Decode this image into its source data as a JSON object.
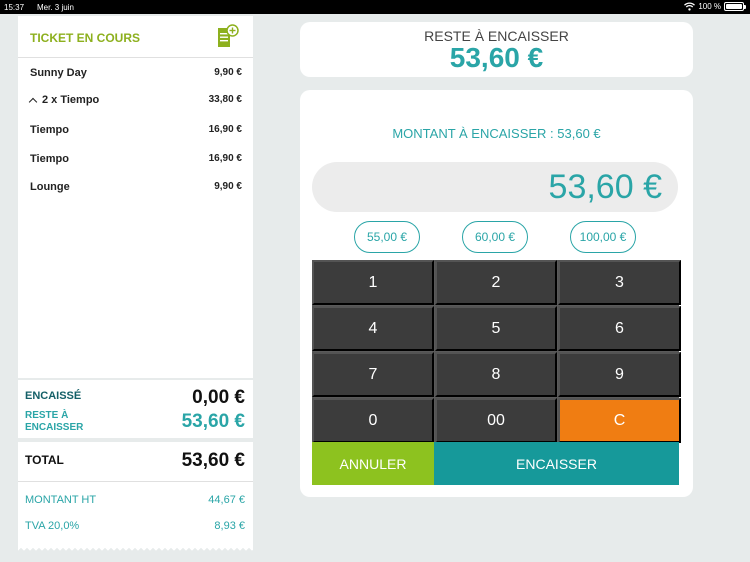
{
  "status_bar": {
    "time": "15:37",
    "date": "Mer. 3 juin",
    "battery": "100 %"
  },
  "ticket": {
    "title": "TICKET EN COURS",
    "items": [
      {
        "name": "Sunny Day",
        "price": "9,90 €"
      },
      {
        "name": "2 x Tiempo",
        "price": "33,80 €"
      },
      {
        "name": "Tiempo",
        "price": "16,90 €"
      },
      {
        "name": "Tiempo",
        "price": "16,90 €"
      },
      {
        "name": "Lounge",
        "price": "9,90 €"
      }
    ]
  },
  "summary": {
    "encaisse_label": "ENCAISSÉ",
    "encaisse_value": "0,00 €",
    "reste_label": "RESTE À ENCAISSER",
    "reste_value": "53,60 €"
  },
  "totals": {
    "total_label": "TOTAL",
    "total_value": "53,60 €",
    "ht_label": "MONTANT HT",
    "ht_value": "44,67 €",
    "tva_label": "TVA 20,0%",
    "tva_value": "8,93 €"
  },
  "header_card": {
    "label": "RESTE À ENCAISSER",
    "value": "53,60 €"
  },
  "payment": {
    "montant_label": "MONTANT À ENCAISSER : 53,60 €",
    "display_value": "53,60 €",
    "quick_amounts": [
      "55,00 €",
      "60,00 €",
      "100,00 €"
    ],
    "keys": [
      "1",
      "2",
      "3",
      "4",
      "5",
      "6",
      "7",
      "8",
      "9",
      "0",
      "00",
      "C"
    ],
    "cancel_label": "ANNULER",
    "collect_label": "ENCAISSER"
  },
  "colors": {
    "accent_teal": "#2aa5a7",
    "accent_green": "#8db01e",
    "clear_orange": "#f07d12"
  }
}
